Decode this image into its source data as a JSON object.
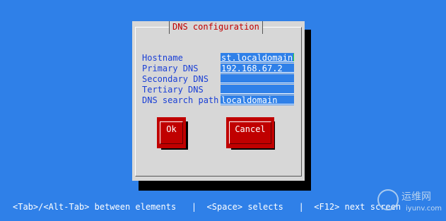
{
  "dialog": {
    "title": "DNS configuration",
    "fields": [
      {
        "label": "Hostname",
        "value": "st.localdomain",
        "focused": true
      },
      {
        "label": "Primary DNS",
        "value": "192.168.67.2"
      },
      {
        "label": "Secondary DNS",
        "value": ""
      },
      {
        "label": "Tertiary DNS",
        "value": ""
      },
      {
        "label": "DNS search path",
        "value": "localdomain"
      }
    ],
    "buttons": {
      "ok": "Ok",
      "cancel": "Cancel"
    }
  },
  "status_bar": {
    "text": "<Tab>/<Alt-Tab> between elements   |  <Space> selects   |  <F12> next screen"
  },
  "watermark": {
    "brand": "运维网",
    "url": "iyunv.com"
  },
  "colors": {
    "background": "#2f80e8",
    "dialog": "#d7d7d7",
    "title": "#c00000",
    "label": "#1a3fd6",
    "button": "#c00000",
    "cursor": "#2bd82b"
  }
}
